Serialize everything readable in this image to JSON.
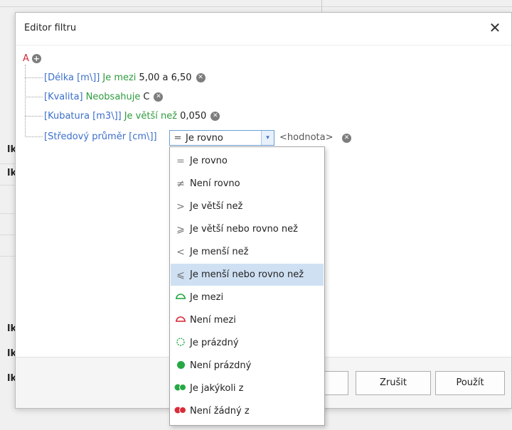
{
  "dialog": {
    "title": "Editor filtru",
    "close_symbol": "✕",
    "cancel_label": "Zrušit",
    "apply_label": "Použít"
  },
  "tree": {
    "root_label": "A",
    "add_symbol": "+",
    "delete_symbol": "✕",
    "conditions": [
      {
        "field": "[Délka [m\\]]",
        "operator": "Je mezi",
        "value": "5,00 a 6,50"
      },
      {
        "field": "[Kvalita]",
        "operator": "Neobsahuje",
        "value": "C"
      },
      {
        "field": "[Kubatura [m3\\]]",
        "operator": "Je větší než",
        "value": "0,050"
      },
      {
        "field": "[Středový průměr [cm\\]]",
        "operator": "Je rovno",
        "value": "<hodnota>"
      }
    ]
  },
  "combo": {
    "symbol": "=",
    "selected": "Je rovno",
    "arrow_symbol": "▾"
  },
  "operator_options": [
    {
      "icon": "=",
      "label": "Je rovno"
    },
    {
      "icon": "≠",
      "label": "Není rovno"
    },
    {
      "icon": ">",
      "label": "Je větší než"
    },
    {
      "icon": "⩾",
      "label": "Je větší nebo rovno než"
    },
    {
      "icon": "<",
      "label": "Je menší než"
    },
    {
      "icon": "⩽",
      "label": "Je menší nebo rovno než"
    },
    {
      "icon": "between-icon",
      "label": "Je mezi"
    },
    {
      "icon": "not-between-icon",
      "label": "Není mezi"
    },
    {
      "icon": "empty-circle-icon",
      "label": "Je prázdný"
    },
    {
      "icon": "filled-circle-icon",
      "label": "Není prázdný"
    },
    {
      "icon": "any-of-icon",
      "label": "Je jakýkoli z"
    },
    {
      "icon": "none-of-icon",
      "label": "Není žádný z"
    }
  ],
  "highlighted_option": "Je menší nebo rovno než",
  "background": {
    "row_letters": [
      "lk",
      "lk",
      "lk",
      "lk",
      "lk"
    ]
  },
  "colors": {
    "field": "#3c6fcc",
    "operator": "#2e9a3e",
    "root": "#d0283a",
    "selection": "#cfe0f3",
    "green_icon": "#27a844",
    "red_icon": "#d92c3a"
  }
}
